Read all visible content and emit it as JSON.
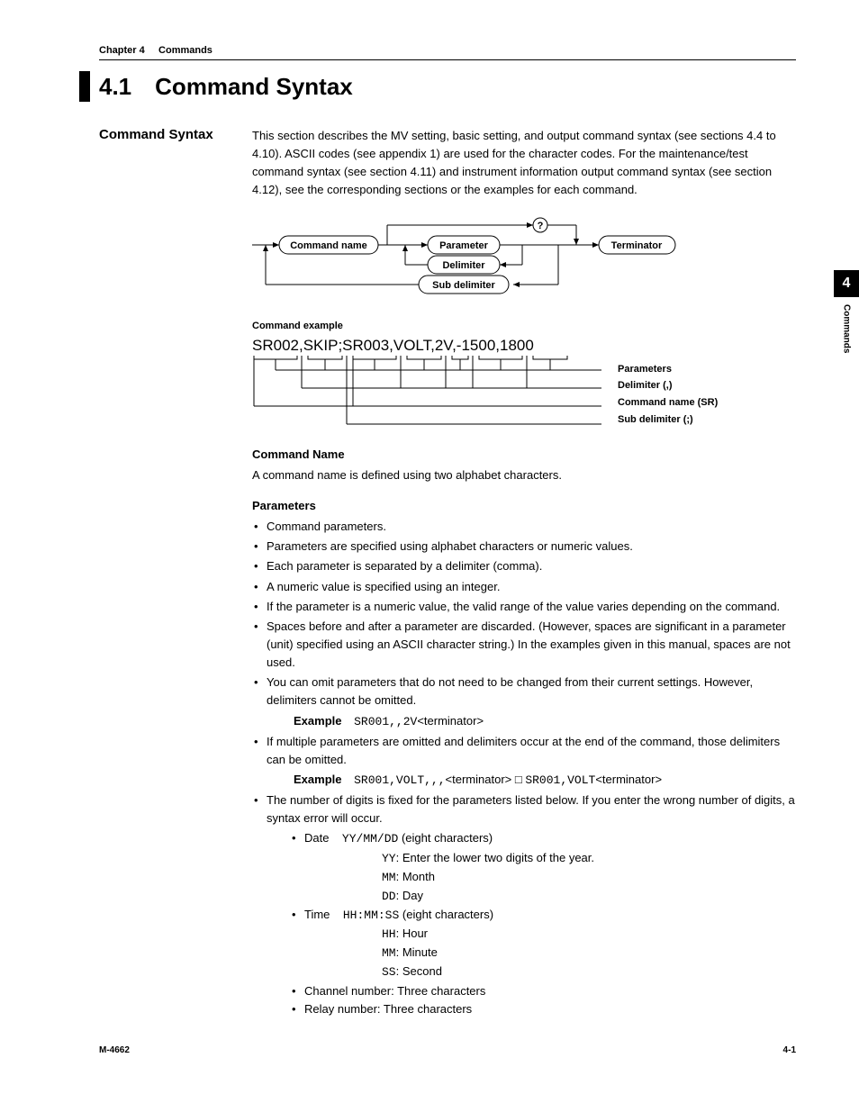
{
  "running_head": {
    "chapter": "Chapter 4",
    "title": "Commands"
  },
  "section": {
    "number": "4.1",
    "title": "Command Syntax"
  },
  "h2_1": "Command Syntax",
  "intro": "This section describes the MV setting, basic setting, and output command syntax (see sections 4.4 to 4.10). ASCII codes (see appendix 1) are used for the character codes. For the maintenance/test command syntax (see section 4.11) and instrument information output command syntax (see section 4.12), see the corresponding sections or the examples for each command.",
  "diagram": {
    "command_name": "Command name",
    "parameter": "Parameter",
    "terminator": "Terminator",
    "delimiter": "Delimiter",
    "sub_delimiter": "Sub delimiter",
    "question": "?"
  },
  "cmd_example_label": "Command example",
  "cmd_example_code": "SR002,SKIP;SR003,VOLT,2V,-1500,1800",
  "legend": {
    "parameters": "Parameters",
    "delimiter": "Delimiter (,)",
    "command_name": "Command name (SR)",
    "sub_delimiter": "Sub delimiter (;)"
  },
  "h3_cmdname": "Command Name",
  "cmdname_text": "A command name is defined using two alphabet characters.",
  "h3_params": "Parameters",
  "bullets": {
    "b1": "Command parameters.",
    "b2": "Parameters are specified using alphabet characters or numeric values.",
    "b3": "Each parameter is separated by a delimiter (comma).",
    "b4": "A numeric value is specified using an integer.",
    "b5": "If the parameter is a numeric value, the valid range of the value varies depending on the command.",
    "b6": "Spaces before and after a parameter are discarded. (However, spaces are significant in a parameter (unit) specified using an ASCII character string.) In the examples given in this manual, spaces are not used.",
    "b7": "You can omit parameters that do not need to be changed from their current settings. However, delimiters cannot be omitted.",
    "b8": "If multiple parameters are omitted and delimiters occur at the end of the command, those delimiters can be omitted.",
    "b9": "The number of digits is fixed for the parameters listed below. If you enter the wrong number of digits, a syntax error will occur."
  },
  "ex1": {
    "label": "Example",
    "code": "SR001,,2V",
    "term": "<terminator>"
  },
  "ex2": {
    "label": "Example",
    "code1": "SR001,VOLT,,,",
    "term1": "<terminator>",
    "arrow": " □ ",
    "code2": "SR001,VOLT",
    "term2": "<terminator>"
  },
  "date_time": {
    "date_label": "Date",
    "date_fmt": "YY/MM/DD",
    "date_desc": " (eight characters)",
    "yy": "YY",
    "yy_desc": ": Enter the lower two digits of the year.",
    "mm": "MM",
    "mm_desc": ": Month",
    "dd": "DD",
    "dd_desc": ": Day",
    "time_label": "Time",
    "time_fmt": "HH:MM:SS",
    "time_desc": " (eight characters)",
    "hh": "HH",
    "hh_desc": ": Hour",
    "mn": "MM",
    "mn_desc": ": Minute",
    "ss": "SS",
    "ss_desc": ": Second",
    "channel": "Channel number: Three characters",
    "relay": "Relay number: Three characters"
  },
  "side": {
    "num": "4",
    "label": "Commands"
  },
  "footer": {
    "left": "M-4662",
    "right": "4-1"
  }
}
